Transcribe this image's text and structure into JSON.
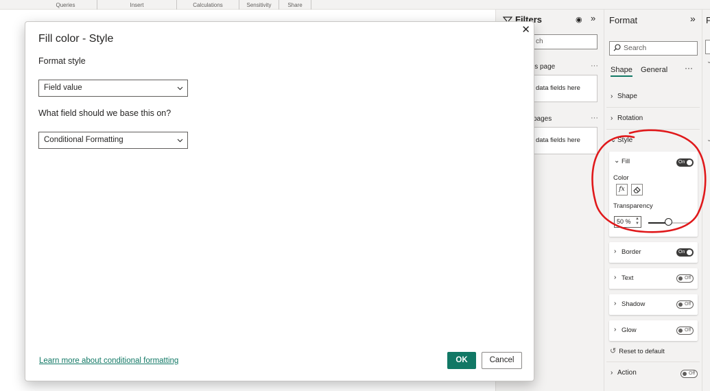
{
  "ribbon": {
    "groups": [
      "Queries",
      "Insert",
      "Calculations",
      "Sensitivity",
      "Share"
    ]
  },
  "filters_pane": {
    "title": "Filters",
    "search_placeholder": "ch",
    "section1_label": "is page",
    "section1_drop": "data fields here",
    "section2_label": "pages",
    "section2_drop": "data fields here",
    "more": "···"
  },
  "format_pane": {
    "title": "Format",
    "search_placeholder": "Search",
    "tabs": [
      "Shape",
      "General"
    ],
    "more": "···",
    "categories": {
      "shape": "Shape",
      "rotation": "Rotation",
      "style": "Style",
      "action": "Action"
    },
    "fill_card": {
      "name": "Fill",
      "toggle": "On",
      "color_label": "Color",
      "fx": "fx",
      "transparency_label": "Transparency",
      "transparency_value": "50",
      "transparency_unit": "%",
      "transparency_fraction": 0.5
    },
    "cards": [
      {
        "name": "Border",
        "toggle": "On"
      },
      {
        "name": "Text",
        "toggle": "Off"
      },
      {
        "name": "Shadow",
        "toggle": "Off"
      },
      {
        "name": "Glow",
        "toggle": "Off"
      }
    ],
    "action_toggle": "Off",
    "reset": "Reset to default"
  },
  "fields_strip": {
    "title": "F"
  },
  "dialog": {
    "title": "Fill color - Style",
    "format_style_label": "Format style",
    "format_style_value": "Field value",
    "base_field_label": "What field should we base this on?",
    "base_field_value": "Conditional Formatting",
    "learn_more": "Learn more about conditional formatting",
    "ok": "OK",
    "cancel": "Cancel"
  },
  "colors": {
    "accent": "#117865",
    "annotation": "#e0191b",
    "pane_bg": "#f3f2f1"
  }
}
